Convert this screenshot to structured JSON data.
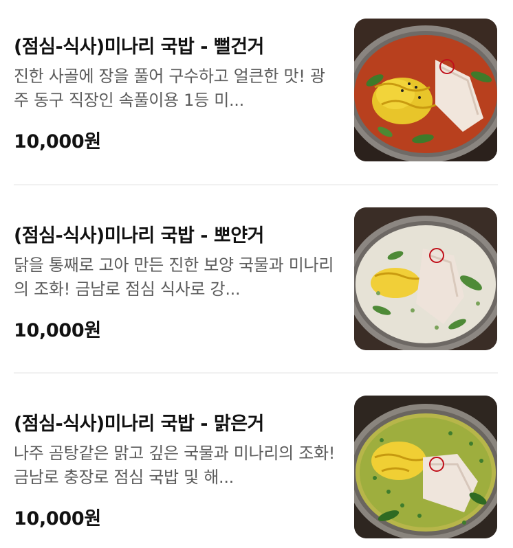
{
  "menu": {
    "items": [
      {
        "title": "(점심-식사)미나리 국밥 - 뻘건거",
        "description": "진한 사골에 장을 풀어 구수하고 얼큰한 맛! 광주 동구 직장인 속풀이용 1등 미...",
        "price": "10,000원",
        "image": "red-spicy-gukbap-photo"
      },
      {
        "title": "(점심-식사)미나리 국밥 - 뽀얀거",
        "description": "닭을 통째로 고아 만든 진한 보양 국물과 미나리의 조화! 금남로 점심 식사로 강...",
        "price": "10,000원",
        "image": "milky-gukbap-photo"
      },
      {
        "title": "(점심-식사)미나리 국밥 - 맑은거",
        "description": "나주 곰탕같은 맑고 깊은 국물과 미나리의 조화!금남로 충장로 점심 국밥 및 해...",
        "price": "10,000원",
        "image": "clear-gukbap-photo"
      }
    ]
  }
}
